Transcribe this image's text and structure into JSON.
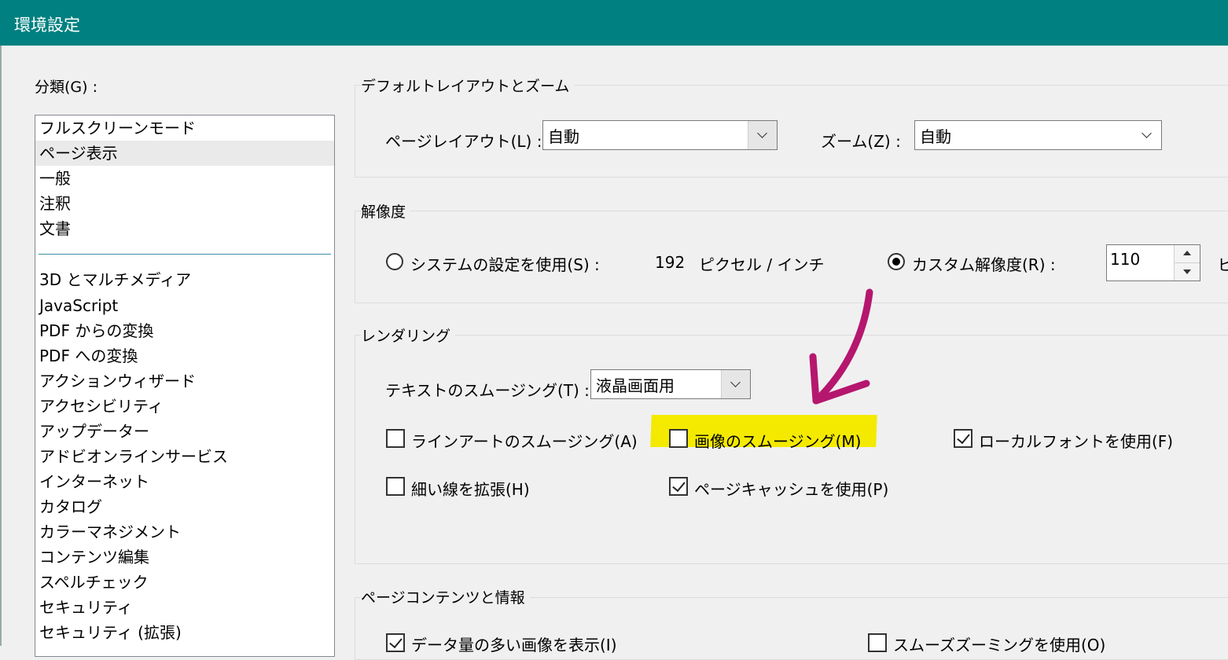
{
  "window": {
    "title": "環境設定"
  },
  "categories": {
    "label": "分類(G) :",
    "group1": [
      "フルスクリーンモード",
      "ページ表示",
      "一般",
      "注釈",
      "文書"
    ],
    "selected": "ページ表示",
    "group2": [
      "3D とマルチメディア",
      "JavaScript",
      "PDF からの変換",
      "PDF への変換",
      "アクションウィザード",
      "アクセシビリティ",
      "アップデーター",
      "アドビオンラインサービス",
      "インターネット",
      "カタログ",
      "カラーマネジメント",
      "コンテンツ編集",
      "スペルチェック",
      "セキュリティ",
      "セキュリティ (拡張)"
    ]
  },
  "layout_zoom": {
    "title": "デフォルトレイアウトとズーム",
    "page_layout_label": "ページレイアウト(L) :",
    "page_layout_value": "自動",
    "zoom_label": "ズーム(Z) :",
    "zoom_value": "自動"
  },
  "resolution": {
    "title": "解像度",
    "system_label": "システムの設定を使用(S) :",
    "system_value": "192",
    "system_unit": "ピクセル / インチ",
    "custom_label": "カスタム解像度(R) :",
    "custom_value": "110",
    "custom_unit_partial": "ピ",
    "selected": "custom"
  },
  "rendering": {
    "title": "レンダリング",
    "text_smoothing_label": "テキストのスムージング(T) :",
    "text_smoothing_value": "液晶画面用",
    "line_art": {
      "label": "ラインアートのスムージング(A)",
      "checked": false
    },
    "image_smoothing": {
      "label": "画像のスムージング(M)",
      "checked": false
    },
    "local_fonts": {
      "label": "ローカルフォントを使用(F)",
      "checked": true
    },
    "thin_lines": {
      "label": "細い線を拡張(H)",
      "checked": false
    },
    "page_cache": {
      "label": "ページキャッシュを使用(P)",
      "checked": true
    }
  },
  "page_content": {
    "title": "ページコンテンツと情報",
    "large_images": {
      "label": "データ量の多い画像を表示(I)",
      "checked": true
    },
    "smooth_zoom": {
      "label": "スムーズズーミングを使用(O)",
      "checked": false
    }
  },
  "annotation": {
    "highlight_color": "#f4ea00",
    "arrow_color": "#b5176e"
  },
  "colors": {
    "titlebar": "#008080",
    "separator": "#3b8ea5"
  }
}
